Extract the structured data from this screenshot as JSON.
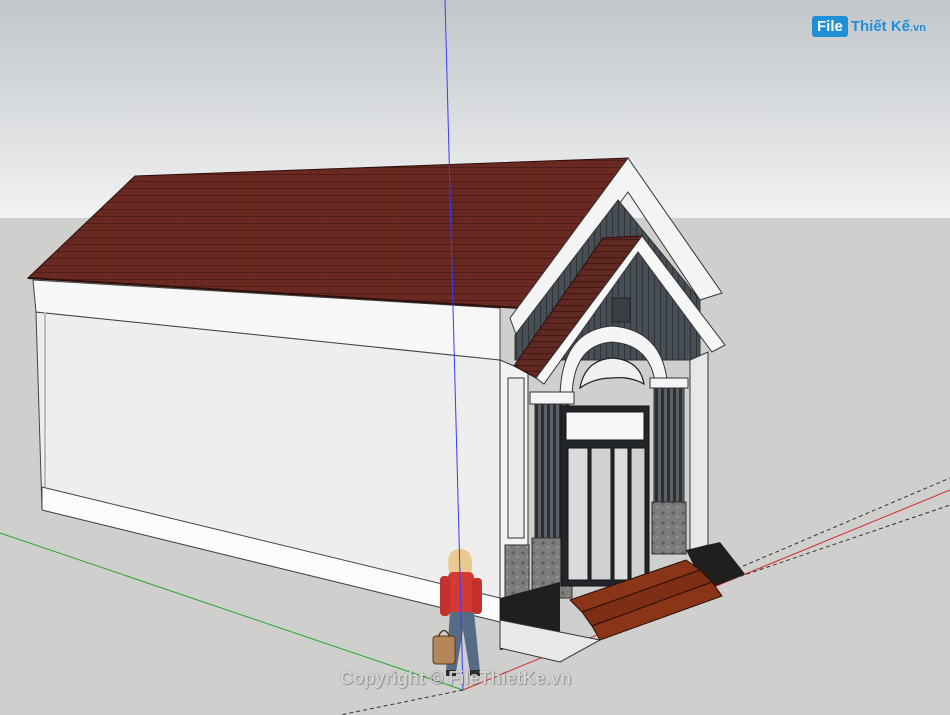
{
  "logo": {
    "file": "File",
    "rest": "Thiết Kế",
    "domain": ".vn"
  },
  "watermark": "Copyright © FileThietKe.vn",
  "colors": {
    "sky_top": "#c2c6ca",
    "sky_bottom": "#f1f2f3",
    "ground": "#cfcfcd",
    "roof": "#6a2a22",
    "wall": "#eeeeee",
    "door_frame": "#22262a",
    "gable": "#484e55",
    "steps": "#8a3418",
    "axis_blue": "#3a3aff",
    "axis_green": "#2aa52a",
    "axis_red": "#d22a2a"
  },
  "icons": [
    "scale-figure-woman",
    "handbag-icon",
    "ornament-icon"
  ]
}
